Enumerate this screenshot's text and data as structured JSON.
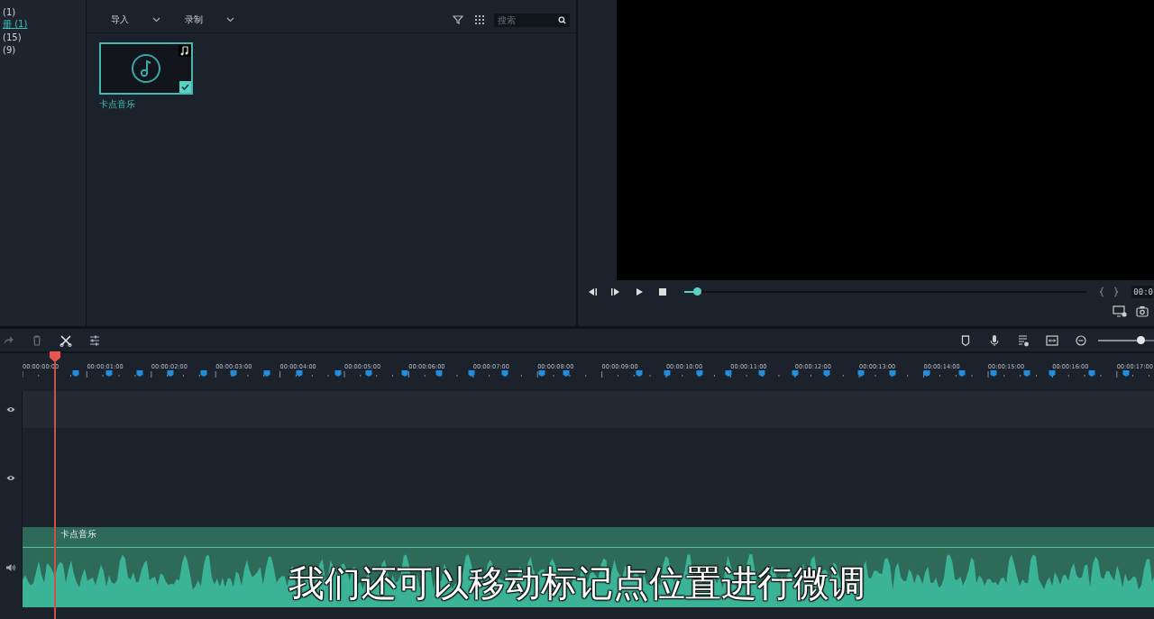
{
  "sidebar": {
    "items": [
      {
        "label": "(1)",
        "selected": false
      },
      {
        "label": "册 (1)",
        "selected": true
      },
      {
        "label": "(15)",
        "selected": false
      },
      {
        "label": "(9)",
        "selected": false
      }
    ]
  },
  "media_toolbar": {
    "menus": [
      "导入",
      "录制"
    ],
    "search": {
      "placeholder": "搜索"
    }
  },
  "media_items": [
    {
      "name": "卡点音乐",
      "selected": true
    }
  ],
  "player": {
    "level": 0.03,
    "timecode": "00:0"
  },
  "timeline": {
    "zoom": {
      "level": 0.75
    },
    "ruler": [
      "00:00:00:00",
      "00:00:01:00",
      "00:00:02:00",
      "00:00:03:00",
      "00:00:04:00",
      "00:00:05:00",
      "00:00:06:00",
      "00:00:07:00",
      "00:00:08:00",
      "00:00:09:00",
      "00:00:10:00",
      "00:00:11:00",
      "00:00:12:00",
      "00:00:13:00",
      "00:00:14:00",
      "00:00:15:00",
      "00:00:16:00",
      "00:00:17:00"
    ],
    "tracks": [
      {
        "kind": "video"
      },
      {
        "kind": "video"
      },
      {
        "kind": "audio",
        "clip": "卡点音乐"
      }
    ]
  },
  "subtitle": "我们还可以移动标记点位置进行微调"
}
